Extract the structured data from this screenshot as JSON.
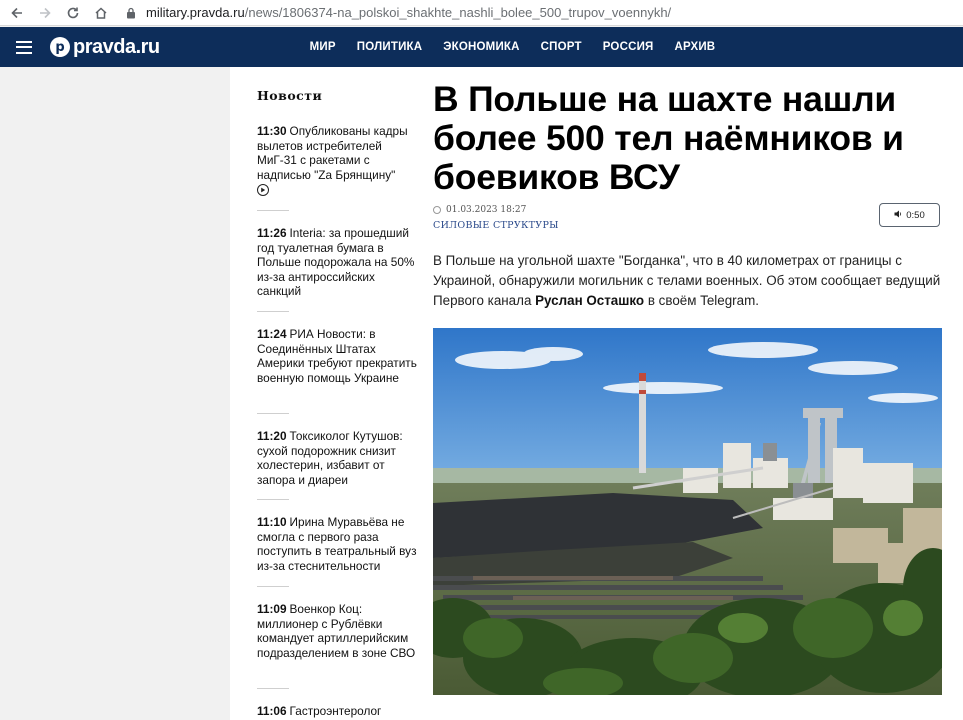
{
  "browser": {
    "url_host": "military.pravda.ru",
    "url_path": "/news/1806374-na_polskoi_shakhte_nashli_bolee_500_trupov_voennykh/"
  },
  "site": {
    "logo_text": "pravda.ru",
    "nav": [
      "МИР",
      "ПОЛИТИКА",
      "ЭКОНОМИКА",
      "СПОРТ",
      "РОССИЯ",
      "АРХИВ"
    ]
  },
  "news": {
    "heading": "Новости",
    "items": [
      {
        "time": "11:30",
        "text": "Опубликованы кадры вылетов истребителей МиГ-31 с ракетами с надписью \"Zа Брянщину\""
      },
      {
        "time": "11:26",
        "text": "Interia: за прошедший год туалетная бумага в Польше подорожала на 50% из-за антироссийских санкций"
      },
      {
        "time": "11:24",
        "text": "РИА Новости: в Соединённых Штатах Америки требуют прекратить военную помощь Украине"
      },
      {
        "time": "11:20",
        "text": "Токсиколог Кутушов: сухой подорожник снизит холестерин, избавит от запора и диареи"
      },
      {
        "time": "11:10",
        "text": "Ирина Муравьёва не смогла с первого раза поступить в театральный вуз из-за стеснительности"
      },
      {
        "time": "11:09",
        "text": "Военкор Коц: миллионер с Рублёвки командует артиллерийским подразделением в зоне СВО"
      },
      {
        "time": "11:06",
        "text": "Гастроэнтеролог"
      }
    ]
  },
  "article": {
    "headline": "В Польше на шахте нашли более 500 тел наёмников и боевиков ВСУ",
    "date": "01.03.2023 18:27",
    "category": "СИЛОВЫЕ СТРУКТУРЫ",
    "audio_duration": "0:50",
    "lead_before": "В Польше на угольной шахте \"Богданка\", что в 40 километрах от границы с Украиной, обнаружили могильник с телами военных. Об этом сообщает ведущий Первого канала ",
    "lead_bold": "Руслан Осташко",
    "lead_after": " в своём Telegram."
  },
  "colors": {
    "header_bg": "#0d2d5a",
    "category": "#2b4a8b"
  }
}
